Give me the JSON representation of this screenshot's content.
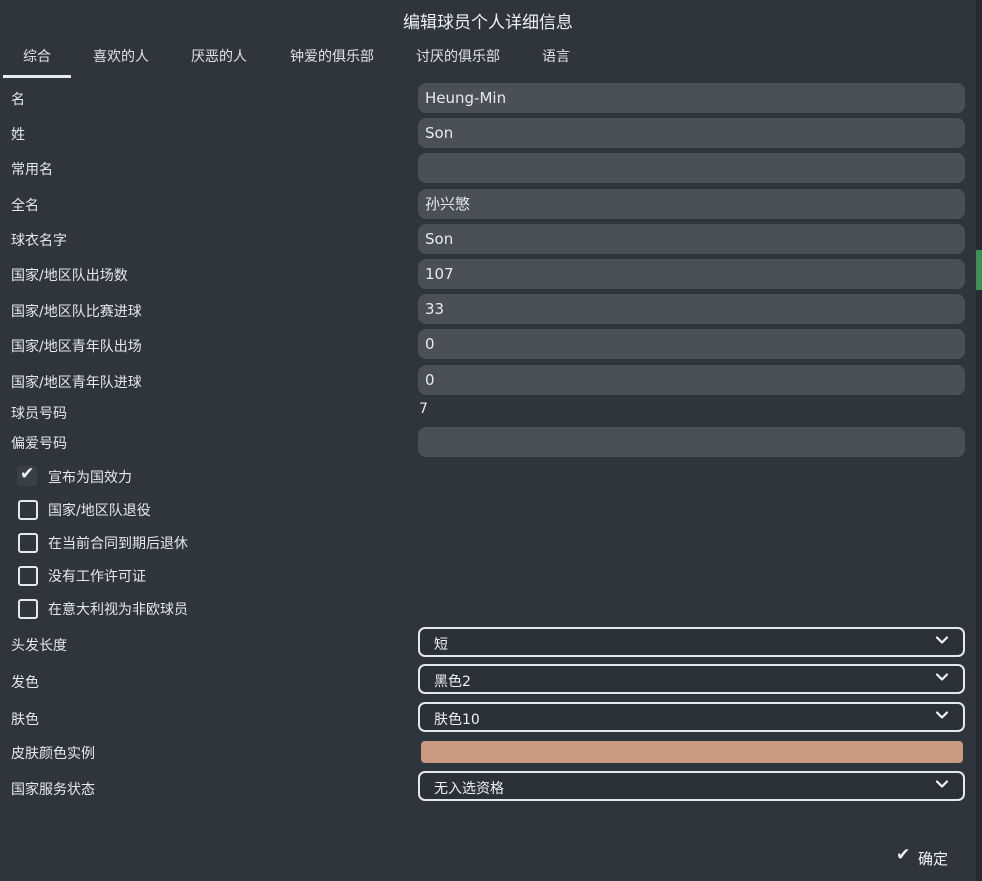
{
  "dialog": {
    "title": "编辑球员个人详细信息"
  },
  "tabs": [
    {
      "label": "综合",
      "active": true
    },
    {
      "label": "喜欢的人",
      "active": false
    },
    {
      "label": "厌恶的人",
      "active": false
    },
    {
      "label": "钟爱的俱乐部",
      "active": false
    },
    {
      "label": "讨厌的俱乐部",
      "active": false
    },
    {
      "label": "语言",
      "active": false
    }
  ],
  "fields": {
    "first_name": {
      "label": "名",
      "value": "Heung-Min"
    },
    "last_name": {
      "label": "姓",
      "value": "Son"
    },
    "common_name": {
      "label": "常用名",
      "value": ""
    },
    "full_name": {
      "label": "全名",
      "value": "孙兴慜"
    },
    "shirt_name": {
      "label": "球衣名字",
      "value": "Son"
    },
    "intl_apps": {
      "label": "国家/地区队出场数",
      "value": "107"
    },
    "intl_goals": {
      "label": "国家/地区队比赛进球",
      "value": "33"
    },
    "youth_apps": {
      "label": "国家/地区青年队出场",
      "value": "0"
    },
    "youth_goals": {
      "label": "国家/地区青年队进球",
      "value": "0"
    },
    "squad_number": {
      "label": "球员号码",
      "value": "7"
    },
    "preferred_number": {
      "label": "偏爱号码",
      "value": ""
    }
  },
  "checkboxes": [
    {
      "label": "宣布为国效力",
      "checked": true
    },
    {
      "label": "国家/地区队退役",
      "checked": false
    },
    {
      "label": "在当前合同到期后退休",
      "checked": false
    },
    {
      "label": "没有工作许可证",
      "checked": false
    },
    {
      "label": "在意大利视为非欧球员",
      "checked": false
    }
  ],
  "selects": {
    "hair_length": {
      "label": "头发长度",
      "value": "短"
    },
    "hair_color": {
      "label": "发色",
      "value": "黑色2"
    },
    "skin_tone": {
      "label": "肤色",
      "value": "肤色10"
    },
    "national_service": {
      "label": "国家服务状态",
      "value": "无入选资格"
    }
  },
  "skin_sample": {
    "label": "皮肤颜色实例",
    "color": "#c99a80"
  },
  "footer": {
    "ok_label": "确定"
  },
  "colors": {
    "accent": "#3e8f55",
    "field_bg": "#4a5057",
    "panel_bg": "#2f353c"
  }
}
